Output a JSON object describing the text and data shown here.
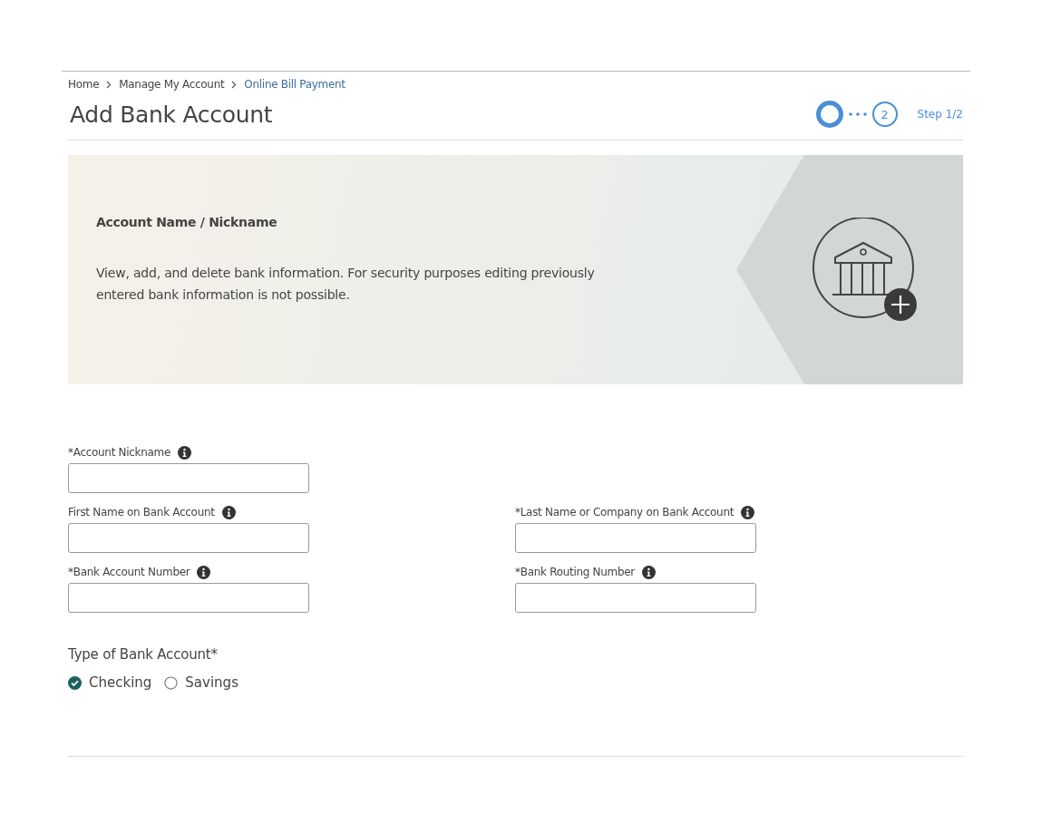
{
  "breadcrumb": [
    {
      "label": "Home",
      "current": false
    },
    {
      "label": "Manage My Account",
      "current": false
    },
    {
      "label": "Online Bill Payment",
      "current": true
    }
  ],
  "title": "Add Bank Account",
  "steps": [
    {
      "selected": true
    },
    {
      "label": "2",
      "selected": false
    }
  ],
  "step_text": "Step 1/2",
  "banner": {
    "heading": "Account Name / Nickname",
    "text": "View, add, and delete bank information. For security purposes editing previously entered bank information is not possible."
  },
  "form_rows": [
    [
      {
        "label": "*Account Nickname"
      }
    ],
    [
      {
        "label": "First Name on Bank Account"
      },
      {
        "label": "*Last Name or Company on Bank Account"
      }
    ],
    [
      {
        "label": "*Bank Account Number"
      },
      {
        "label": "*Bank Routing Number"
      }
    ]
  ],
  "account_type": {
    "label": "Type of Bank Account*",
    "options": [
      {
        "label": "Checking",
        "selected": true
      },
      {
        "label": "Savings",
        "selected": false
      }
    ]
  }
}
